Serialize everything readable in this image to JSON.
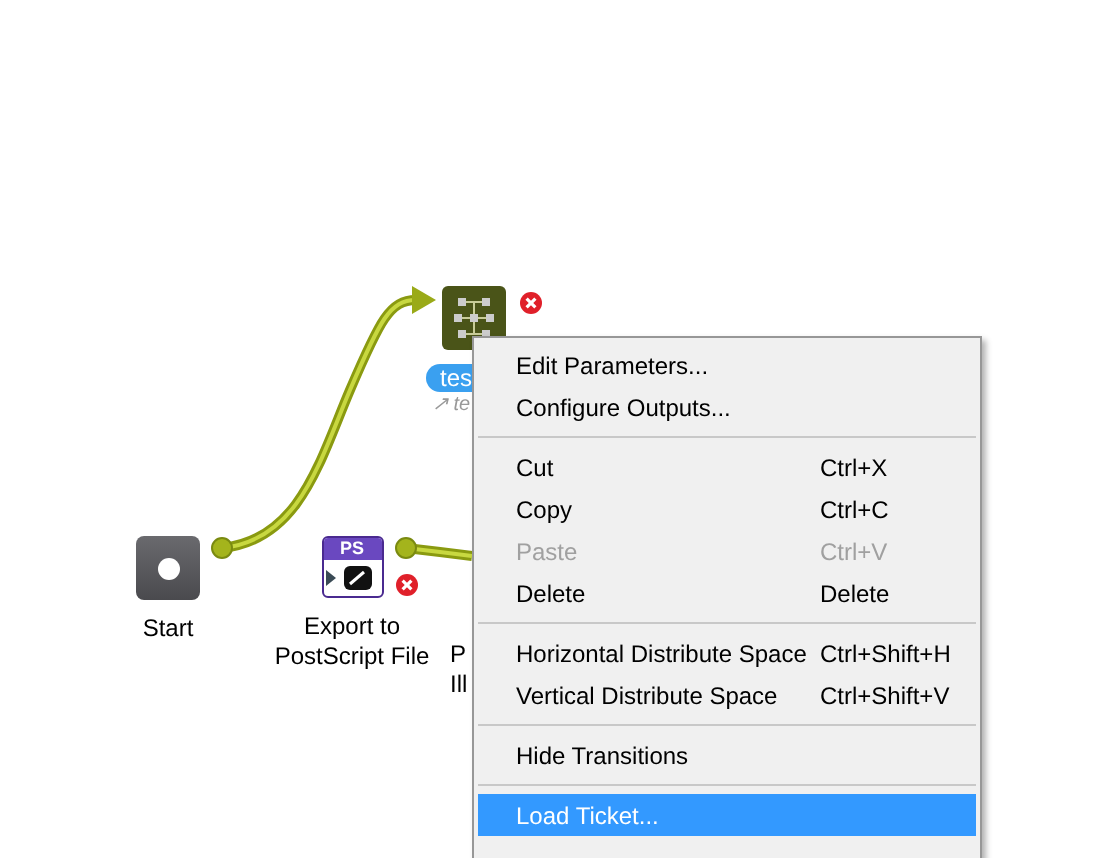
{
  "nodes": [
    {
      "kind": "start",
      "label": "Start",
      "error": false
    },
    {
      "kind": "postscript",
      "badge": "PS",
      "label": "Export to\nPostScript File",
      "error": true
    },
    {
      "kind": "ticket",
      "pill": "tes",
      "sublabel": "↗ te",
      "error": true
    },
    {
      "kind": "partial",
      "label": "P\nIll",
      "error": false
    }
  ],
  "context_menu": [
    {
      "kind": "item",
      "label": "Edit Parameters...",
      "disabled": false,
      "selected": false
    },
    {
      "kind": "item",
      "label": "Configure Outputs...",
      "disabled": false,
      "selected": false
    },
    {
      "kind": "separator"
    },
    {
      "kind": "item",
      "label": "Cut",
      "shortcut": "Ctrl+X",
      "disabled": false,
      "selected": false
    },
    {
      "kind": "item",
      "label": "Copy",
      "shortcut": "Ctrl+C",
      "disabled": false,
      "selected": false
    },
    {
      "kind": "item",
      "label": "Paste",
      "shortcut": "Ctrl+V",
      "disabled": true,
      "selected": false
    },
    {
      "kind": "item",
      "label": "Delete",
      "shortcut": "Delete",
      "disabled": false,
      "selected": false
    },
    {
      "kind": "separator"
    },
    {
      "kind": "item",
      "label": "Horizontal Distribute Space",
      "shortcut": "Ctrl+Shift+H",
      "disabled": false,
      "selected": false
    },
    {
      "kind": "item",
      "label": "Vertical Distribute Space",
      "shortcut": "Ctrl+Shift+V",
      "disabled": false,
      "selected": false
    },
    {
      "kind": "separator"
    },
    {
      "kind": "item",
      "label": "Hide Transitions",
      "disabled": false,
      "selected": false
    },
    {
      "kind": "separator"
    },
    {
      "kind": "item",
      "label": "Load Ticket...",
      "disabled": false,
      "selected": true
    }
  ]
}
